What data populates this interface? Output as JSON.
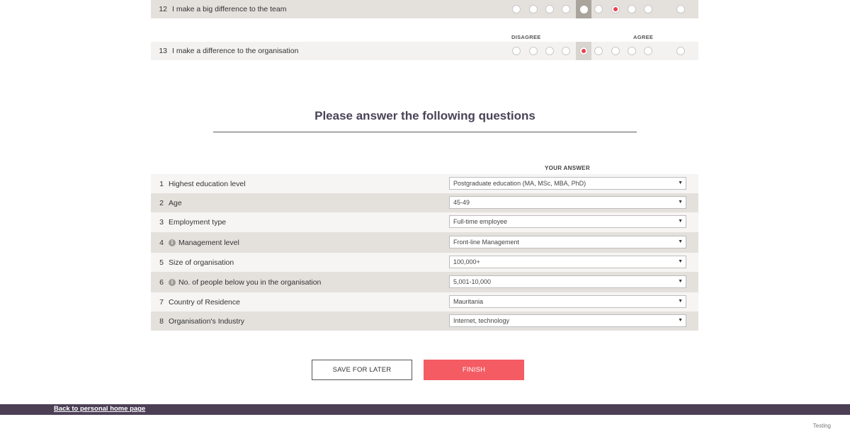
{
  "rating_questions": [
    {
      "number": "12",
      "text": "I make a big difference to the team"
    },
    {
      "number": "13",
      "text": "I make a difference to the organisation"
    }
  ],
  "scale": {
    "disagree_label": "DISAGREE",
    "agree_label": "AGREE"
  },
  "section": {
    "title": "Please answer the following questions",
    "answer_header": "YOUR ANSWER"
  },
  "questions": [
    {
      "number": "1",
      "label": "Highest education level",
      "info": false,
      "answer": "Postgraduate education (MA, MSc, MBA, PhD)"
    },
    {
      "number": "2",
      "label": "Age",
      "info": false,
      "answer": "45-49"
    },
    {
      "number": "3",
      "label": "Employment type",
      "info": false,
      "answer": "Full-time employee"
    },
    {
      "number": "4",
      "label": "Management level",
      "info": true,
      "answer": "Front-line Management"
    },
    {
      "number": "5",
      "label": "Size of organisation",
      "info": false,
      "answer": "100,000+"
    },
    {
      "number": "6",
      "label": "No. of people below you in the organisation",
      "info": true,
      "answer": "5,001-10,000"
    },
    {
      "number": "7",
      "label": "Country of Residence",
      "info": false,
      "answer": "Mauritania"
    },
    {
      "number": "8",
      "label": "Organisation's Industry",
      "info": false,
      "answer": "Internet, technology"
    }
  ],
  "buttons": {
    "save_label": "SAVE FOR LATER",
    "finish_label": "FINISH"
  },
  "footer": {
    "link_text": "Back to personal home page",
    "note": "Testing"
  },
  "colors": {
    "accent": "#f45b63",
    "footer_bg": "#4b3e55",
    "title": "#4a4357"
  }
}
